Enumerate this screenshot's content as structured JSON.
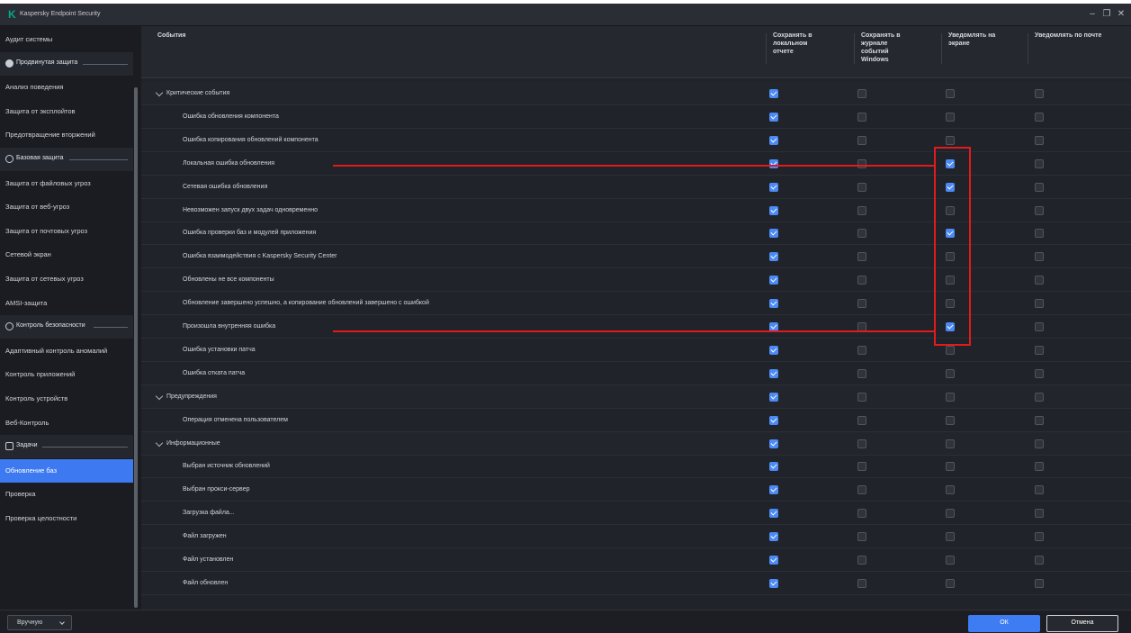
{
  "window": {
    "title": "Kaspersky Endpoint Security",
    "logo_icon": "kaspersky-k-logo",
    "controls": [
      "–",
      "❐",
      "✕"
    ]
  },
  "sidebar": {
    "items": [
      {
        "kind": "item",
        "label": "Аудит системы",
        "active": false
      },
      {
        "kind": "section",
        "label": "Продвинутая защита",
        "icon": "shield-filled-icon"
      },
      {
        "kind": "item",
        "label": "Анализ поведения",
        "active": false
      },
      {
        "kind": "item",
        "label": "Защита от эксплойтов",
        "active": false
      },
      {
        "kind": "item",
        "label": "Предотвращение вторжений",
        "active": false
      },
      {
        "kind": "section",
        "label": "Базовая защита",
        "icon": "circle-outline-icon"
      },
      {
        "kind": "item",
        "label": "Защита от файловых угроз",
        "active": false
      },
      {
        "kind": "item",
        "label": "Защита от веб-угроз",
        "active": false
      },
      {
        "kind": "item",
        "label": "Защита от почтовых угроз",
        "active": false
      },
      {
        "kind": "item",
        "label": "Сетевой экран",
        "active": false
      },
      {
        "kind": "item",
        "label": "Защита от сетевых угроз",
        "active": false
      },
      {
        "kind": "item",
        "label": "AMSI-защита",
        "active": false
      },
      {
        "kind": "section",
        "label": "Контроль безопасности",
        "icon": "circle-outline-icon"
      },
      {
        "kind": "item",
        "label": "Адаптивный контроль аномалий",
        "active": false
      },
      {
        "kind": "item",
        "label": "Контроль приложений",
        "active": false
      },
      {
        "kind": "item",
        "label": "Контроль устройств",
        "active": false
      },
      {
        "kind": "item",
        "label": "Веб-Контроль",
        "active": false
      },
      {
        "kind": "section",
        "label": "Задачи",
        "icon": "calendar-icon"
      },
      {
        "kind": "item",
        "label": "Обновление баз",
        "active": true
      },
      {
        "kind": "item",
        "label": "Проверка",
        "active": false
      },
      {
        "kind": "item",
        "label": "Проверка целостности",
        "active": false
      }
    ]
  },
  "table": {
    "columns": [
      "События",
      "Сохранять в\nлокальном\nотчете",
      "Сохранять в\nжурнале\nсобытий\nWindows",
      "Уведомлять на\nэкране",
      "Уведомлять по почте"
    ],
    "rows": [
      {
        "label": "Критические события",
        "group": true,
        "checks": [
          true,
          false,
          false,
          false
        ]
      },
      {
        "label": "Ошибка обновления компонента",
        "group": false,
        "checks": [
          true,
          false,
          false,
          false
        ]
      },
      {
        "label": "Ошибка копирования обновлений компонента",
        "group": false,
        "checks": [
          true,
          false,
          false,
          false
        ]
      },
      {
        "label": "Локальная ошибка обновления",
        "group": false,
        "checks": [
          true,
          false,
          true,
          false
        ]
      },
      {
        "label": "Сетевая ошибка обновления",
        "group": false,
        "checks": [
          true,
          false,
          true,
          false
        ]
      },
      {
        "label": "Невозможен запуск двух задач одновременно",
        "group": false,
        "checks": [
          true,
          false,
          false,
          false
        ]
      },
      {
        "label": "Ошибка проверки баз и модулей приложения",
        "group": false,
        "checks": [
          true,
          false,
          true,
          false
        ]
      },
      {
        "label": "Ошибка взаимодействия с Kaspersky Security Center",
        "group": false,
        "checks": [
          true,
          false,
          false,
          false
        ]
      },
      {
        "label": "Обновлены не все компоненты",
        "group": false,
        "checks": [
          true,
          false,
          false,
          false
        ]
      },
      {
        "label": "Обновление завершено успешно, а копирование обновлений завершено с ошибкой",
        "group": false,
        "checks": [
          true,
          false,
          false,
          false
        ]
      },
      {
        "label": "Произошла внутренняя ошибка",
        "group": false,
        "checks": [
          true,
          false,
          true,
          false
        ]
      },
      {
        "label": "Ошибка установки патча",
        "group": false,
        "checks": [
          true,
          false,
          false,
          false
        ]
      },
      {
        "label": "Ошибка отката патча",
        "group": false,
        "checks": [
          true,
          false,
          false,
          false
        ]
      },
      {
        "label": "Предупреждения",
        "group": true,
        "checks": [
          true,
          false,
          false,
          false
        ]
      },
      {
        "label": "Операция отменена пользователем",
        "group": false,
        "checks": [
          true,
          false,
          false,
          false
        ]
      },
      {
        "label": "Информационные",
        "group": true,
        "checks": [
          true,
          false,
          false,
          false
        ]
      },
      {
        "label": "Выбран источник обновлений",
        "group": false,
        "checks": [
          true,
          false,
          false,
          false
        ]
      },
      {
        "label": "Выбран прокси-сервер",
        "group": false,
        "checks": [
          true,
          false,
          false,
          false
        ]
      },
      {
        "label": "Загрузка файла...",
        "group": false,
        "checks": [
          true,
          false,
          false,
          false
        ]
      },
      {
        "label": "Файл загружен",
        "group": false,
        "checks": [
          true,
          false,
          false,
          false
        ]
      },
      {
        "label": "Файл установлен",
        "group": false,
        "checks": [
          true,
          false,
          false,
          false
        ]
      },
      {
        "label": "Файл обновлен",
        "group": false,
        "checks": [
          true,
          false,
          false,
          false
        ]
      }
    ]
  },
  "footer": {
    "mode_label": "Вручную",
    "ok_label": "ОК",
    "cancel_label": "Отмена"
  },
  "colors": {
    "accent": "#3d79f0",
    "annotation": "#e11b1b"
  }
}
